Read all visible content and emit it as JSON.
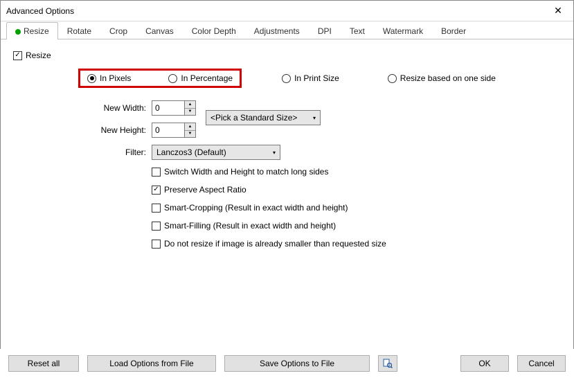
{
  "window": {
    "title": "Advanced Options"
  },
  "tabs": [
    "Resize",
    "Rotate",
    "Crop",
    "Canvas",
    "Color Depth",
    "Adjustments",
    "DPI",
    "Text",
    "Watermark",
    "Border"
  ],
  "resize_checkbox": {
    "label": "Resize",
    "checked": true
  },
  "mode_radios": {
    "pixels": {
      "label": "In Pixels",
      "checked": true
    },
    "percentage": {
      "label": "In Percentage",
      "checked": false
    },
    "print": {
      "label": "In Print Size",
      "checked": false
    },
    "oneside": {
      "label": "Resize based on one side",
      "checked": false
    }
  },
  "fields": {
    "new_width": {
      "label": "New Width:",
      "value": "0"
    },
    "new_height": {
      "label": "New Height:",
      "value": "0"
    },
    "std_size": {
      "placeholder": "<Pick a Standard Size>"
    },
    "filter": {
      "label": "Filter:",
      "value": "Lanczos3 (Default)"
    }
  },
  "options": {
    "switch_wh": {
      "label": "Switch Width and Height to match long sides",
      "checked": false
    },
    "aspect": {
      "label": "Preserve Aspect Ratio",
      "checked": true
    },
    "smart_crop": {
      "label": "Smart-Cropping (Result in exact width and height)",
      "checked": false
    },
    "smart_fill": {
      "label": "Smart-Filling (Result in exact width and height)",
      "checked": false
    },
    "no_resize_smaller": {
      "label": "Do not resize if image is already smaller than requested size",
      "checked": false
    }
  },
  "footer": {
    "reset": "Reset all",
    "load": "Load Options from File",
    "save": "Save Options to File",
    "ok": "OK",
    "cancel": "Cancel"
  }
}
